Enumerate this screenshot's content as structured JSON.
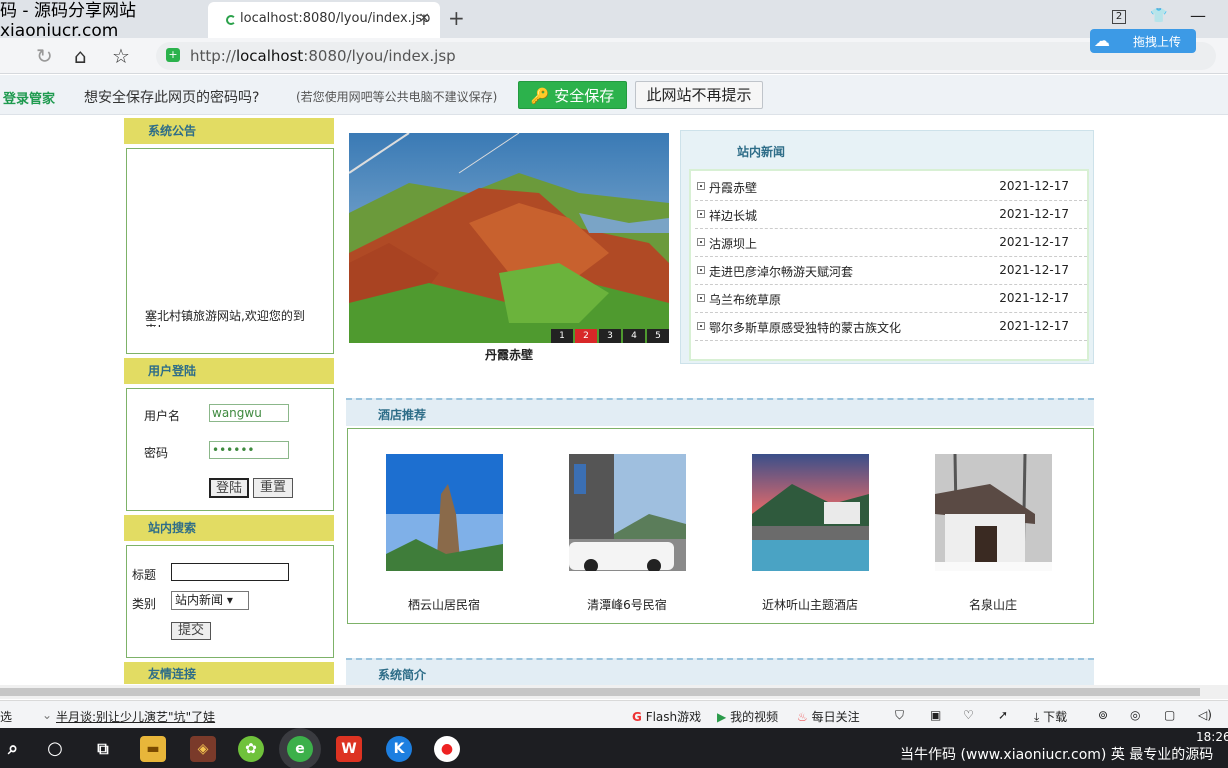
{
  "window": {
    "title": "码 - 源码分享网站",
    "subtitle": "xiaoniucr.com"
  },
  "tab": {
    "label": "localhost:8080/lyou/index.jsp",
    "close": "×",
    "new": "+"
  },
  "toolbar": {
    "tab_count": "2",
    "url_prefix": "http://",
    "url_host": "localhost",
    "url_rest": ":8080/lyou/index.jsp",
    "cloud_upload": "拖拽上传"
  },
  "password_bar": {
    "brand": "登录管家",
    "question": "想安全保存此网页的密码吗?",
    "note": "(若您使用网吧等公共电脑不建议保存)",
    "save_button": "安全保存",
    "never_button": "此网站不再提示"
  },
  "sidebar": {
    "notice_title": "系统公告",
    "notice_text": "塞北村镇旅游网站,欢迎您的到来!",
    "login_title": "用户登陆",
    "username_label": "用户名",
    "username_value": "wangwu",
    "password_label": "密码",
    "password_value": "••••••",
    "login_button": "登陆",
    "reset_button": "重置",
    "search_title": "站内搜索",
    "search_title_label": "标题",
    "search_title_value": "",
    "category_label": "类别",
    "category_selected": "站内新闻",
    "submit_button": "提交",
    "links_title": "友情连接"
  },
  "slideshow": {
    "caption": "丹霞赤壁",
    "pages": [
      "1",
      "2",
      "3",
      "4",
      "5"
    ],
    "active_page": "2"
  },
  "news": {
    "title": "站内新闻",
    "items": [
      {
        "title": "丹霞赤壁",
        "date": "2021-12-17"
      },
      {
        "title": "祥边长城",
        "date": "2021-12-17"
      },
      {
        "title": "沽源坝上",
        "date": "2021-12-17"
      },
      {
        "title": "走进巴彦淖尔畅游天赋河套",
        "date": "2021-12-17"
      },
      {
        "title": "乌兰布统草原",
        "date": "2021-12-17"
      },
      {
        "title": "鄂尔多斯草原感受独特的蒙古族文化",
        "date": "2021-12-17"
      }
    ]
  },
  "hotels": {
    "title": "酒店推荐",
    "items": [
      {
        "name": "栖云山居民宿"
      },
      {
        "name": "清潭峰6号民宿"
      },
      {
        "name": "近林听山主题酒店"
      },
      {
        "name": "名泉山庄"
      }
    ]
  },
  "intro": {
    "title": "系统简介"
  },
  "statusbar": {
    "left": "选",
    "headline": "半月谈:别让少儿演艺\"坑\"了娃",
    "flash": "Flash游戏",
    "video": "我的视频",
    "daily": "每日关注",
    "download": "下载"
  },
  "taskbar": {
    "watermark": "当牛作码 (www.xiaoniucr.com) 英   最专业的源码",
    "time": "18:26"
  }
}
